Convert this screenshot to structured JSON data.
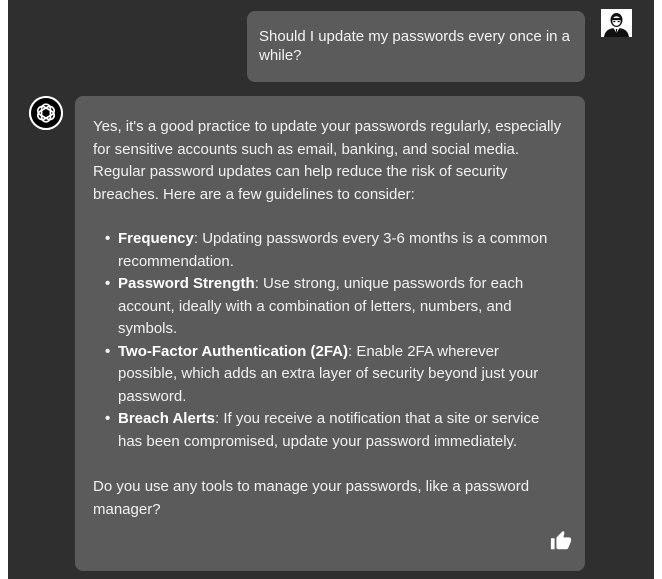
{
  "user_message": {
    "text": "Should I update my passwords every once in a while?"
  },
  "assistant_message": {
    "intro": "Yes, it's a good practice to update your passwords regularly, especially for sensitive accounts such as email, banking, and social media. Regular password updates can help reduce the risk of security breaches. Here are a few guidelines to consider:",
    "guidelines": [
      {
        "term": "Frequency",
        "text": ": Updating passwords every 3-6 months is a common recommendation."
      },
      {
        "term": "Password Strength",
        "text": ": Use strong, unique passwords for each account, ideally with a combination of letters, numbers, and symbols."
      },
      {
        "term": "Two-Factor Authentication (2FA)",
        "text": ": Enable 2FA wherever possible, which adds an extra layer of security beyond just your password."
      },
      {
        "term": "Breach Alerts",
        "text": ": If you receive a notification that a site or service has been compromised, update your password immediately."
      }
    ],
    "closing": "Do you use any tools to manage your passwords, like a password manager?"
  },
  "icons": {
    "user_avatar": "user-avatar-icon",
    "assistant_logo": "openai-logo-icon",
    "feedback": "thumbs-up-icon"
  },
  "colors": {
    "background": "#2f2f2f",
    "bubble": "#5b5b5b",
    "text": "#f1f1f1"
  }
}
